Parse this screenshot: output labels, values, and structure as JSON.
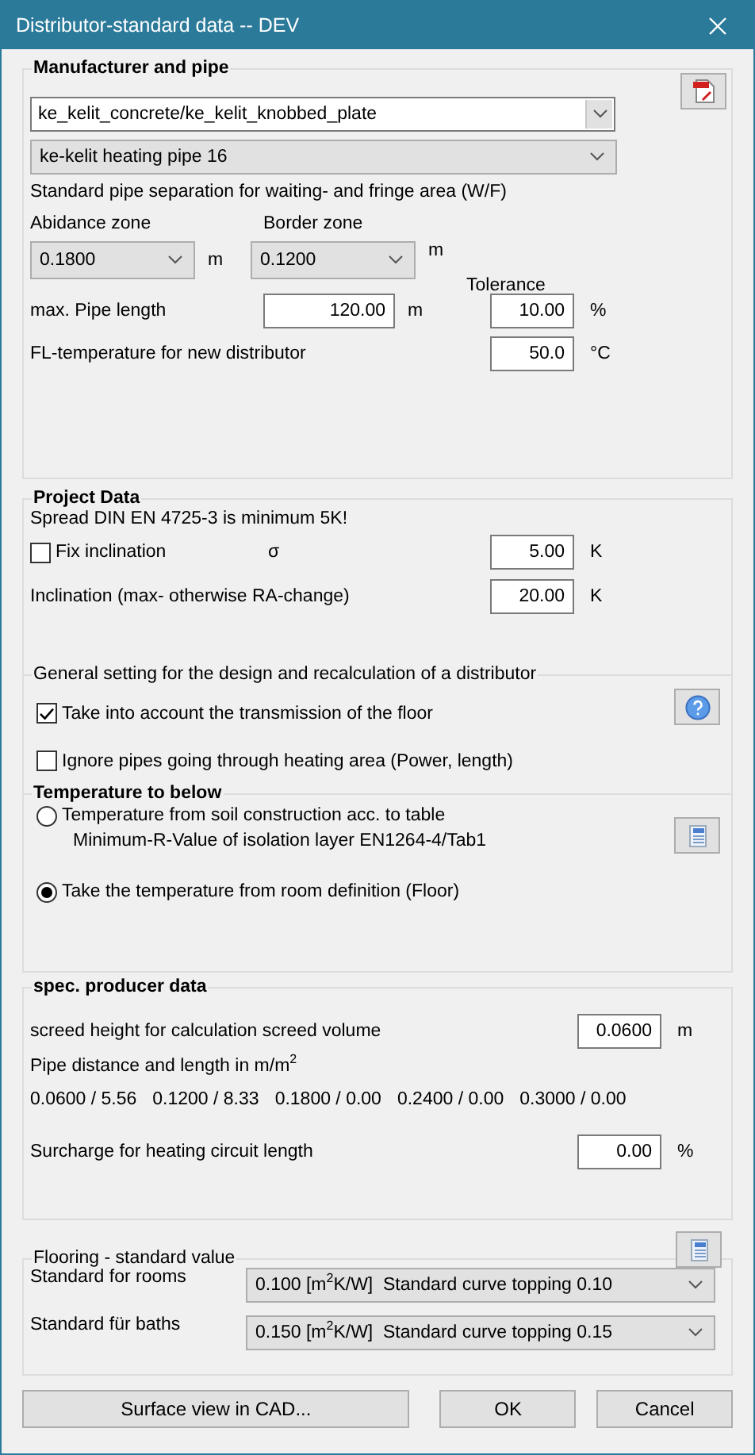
{
  "window": {
    "title": "Distributor-standard data -- DEV"
  },
  "manufacturer": {
    "title": "Manufacturer and pipe",
    "system": {
      "value": "ke_kelit_concrete/ke_kelit_knobbed_plate"
    },
    "pipe": {
      "value": "ke-kelit heating pipe 16"
    },
    "separation_label": "Standard pipe separation for waiting- and fringe area (W/F)",
    "abidance": {
      "label": "Abidance zone",
      "value": "0.1800",
      "unit": "m"
    },
    "border": {
      "label": "Border zone",
      "value": "0.1200",
      "unit": "m"
    },
    "tolerance_label": "Tolerance",
    "max_length": {
      "label": "max. Pipe length",
      "value": "120.00",
      "unit": "m"
    },
    "tolerance": {
      "value": "10.00",
      "unit": "%"
    },
    "fl_temp": {
      "label": "FL-temperature for new distributor",
      "value": "50.0",
      "unit": "°C"
    }
  },
  "project": {
    "title": "Project Data",
    "note": "Spread DIN EN 4725-3 is minimum 5K!",
    "fix": {
      "label": "Fix inclination",
      "checked": false,
      "symbol": "σ",
      "value": "5.00",
      "unit": "K"
    },
    "inclination": {
      "label": "Inclination (max- otherwise RA-change)",
      "value": "20.00",
      "unit": "K"
    },
    "general": {
      "title": "General setting for the design and recalculation of a distributor",
      "options": [
        {
          "label": "Take into account the transmission of the floor",
          "checked": true
        },
        {
          "label": "Ignore pipes going through heating area (Power, length)",
          "checked": false
        }
      ]
    },
    "temperature": {
      "title": "Temperature to below",
      "options": [
        {
          "label": "Temperature from soil construction acc. to table",
          "sublabel": "Minimum-R-Value of isolation layer EN1264-4/Tab1",
          "selected": false
        },
        {
          "label": "Take the temperature from room definition (Floor)",
          "selected": true
        }
      ]
    }
  },
  "producer": {
    "title": "spec. producer data",
    "screed": {
      "label": "screed height for calculation screed volume",
      "value": "0.0600",
      "unit": "m"
    },
    "distance_label": "Pipe distance and length in m/m$^{2}$",
    "distances": [
      "0.0600 / 5.56",
      "0.1200 / 8.33",
      "0.1800 / 0.00",
      "0.2400 / 0.00",
      "0.3000 / 0.00"
    ],
    "surcharge": {
      "label": "Surcharge for heating circuit length",
      "value": "0.00",
      "unit": "%"
    }
  },
  "flooring": {
    "title": "Flooring - standard value",
    "rows": [
      {
        "label": "Standard for rooms",
        "value": "0.100 [m$^{2}$K/W]  Standard curve topping 0.10"
      },
      {
        "label": "Standard für baths",
        "value": "0.150 [m$^{2}$K/W]  Standard curve topping 0.15"
      }
    ]
  },
  "buttons": [
    "Surface view in CAD...",
    "OK",
    "Cancel"
  ]
}
